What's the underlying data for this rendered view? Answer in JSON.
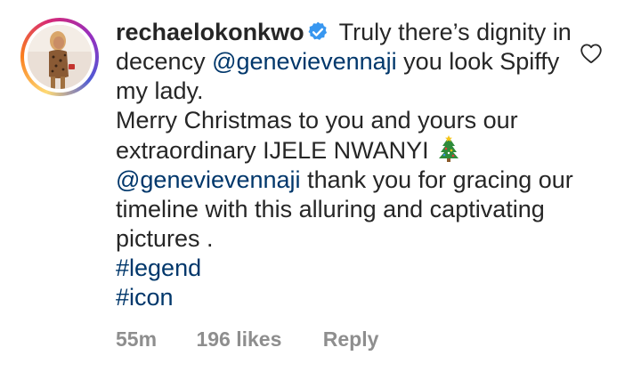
{
  "comment": {
    "username": "rechaelokonkwo",
    "verified_icon": "verified-badge-icon",
    "verified_color": "#3897f0",
    "text_segments": {
      "intro": "Truly there’s dignity in decency",
      "mention1": "@genevievennaji",
      "after_mention1": "you look Spiffy my lady.",
      "line_christmas": "Merry Christmas to you and yours our extraordinary IJELE NWANYI",
      "emoji_name": "christmas-tree-icon",
      "mention2": "@genevievennaji",
      "after_mention2": "thank you for gracing our timeline with this alluring and captivating pictures .",
      "hashtag1": "#legend",
      "hashtag2": "#icon"
    },
    "link_color": "#00376b",
    "time_ago": "55m",
    "likes": "196 likes",
    "reply_label": "Reply",
    "like_icon": "heart-outline-icon"
  }
}
